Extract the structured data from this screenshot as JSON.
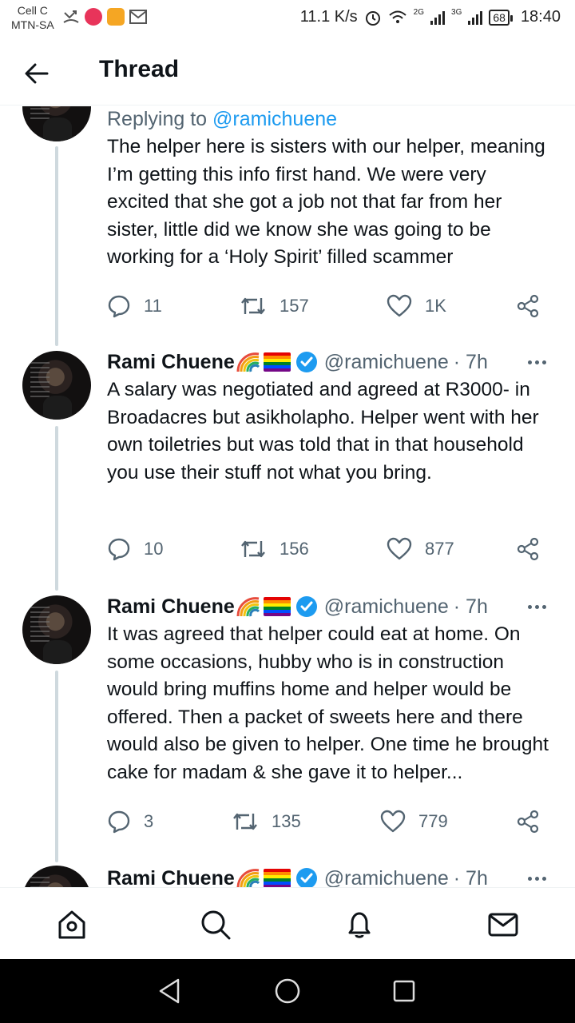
{
  "status_bar": {
    "carrier_line1": "Cell C",
    "carrier_line2": "MTN-SA",
    "network_speed": "11.1 K/s",
    "signal_1": "2G",
    "signal_2": "3G",
    "battery": "68",
    "time": "18:40"
  },
  "header": {
    "title": "Thread",
    "back_icon": "arrow-left-icon"
  },
  "tweets": [
    {
      "replying_prefix": "Replying to ",
      "replying_handle": "@ramichuene",
      "text": "The helper here is sisters with our helper, meaning I’m getting this info first hand. We were very excited that she got a job not that far from her sister, little did we know she was going to be working for a ‘Holy Spirit’ filled scammer",
      "replies": "11",
      "retweets": "157",
      "likes": "1K"
    },
    {
      "name": "Rami Chuene",
      "handle": "@ramichuene",
      "time": "· 7h",
      "text": "A salary was negotiated and agreed at R3000- in Broadacres but asikholapho. Helper went with her own toiletries but was told that in that household you use their stuff not what you bring.",
      "replies": "10",
      "retweets": "156",
      "likes": "877"
    },
    {
      "name": "Rami Chuene",
      "handle": "@ramichuene",
      "time": "· 7h",
      "text": "It was agreed that helper could eat at home. On some occasions, hubby who is in construction would bring muffins home and helper would be offered. Then a packet of sweets here and there would also be given to helper. One time he brought cake for madam & she gave it to helper...",
      "replies": "3",
      "retweets": "135",
      "likes": "779"
    },
    {
      "name": "Rami Chuene",
      "handle": "@ramichuene",
      "time": "· 7h"
    }
  ],
  "bottom_nav": [
    "home-icon",
    "search-icon",
    "notifications-icon",
    "messages-icon"
  ],
  "colors": {
    "accent": "#1d9bf0",
    "secondary_text": "#536471",
    "thread_line": "#cfd9de"
  }
}
